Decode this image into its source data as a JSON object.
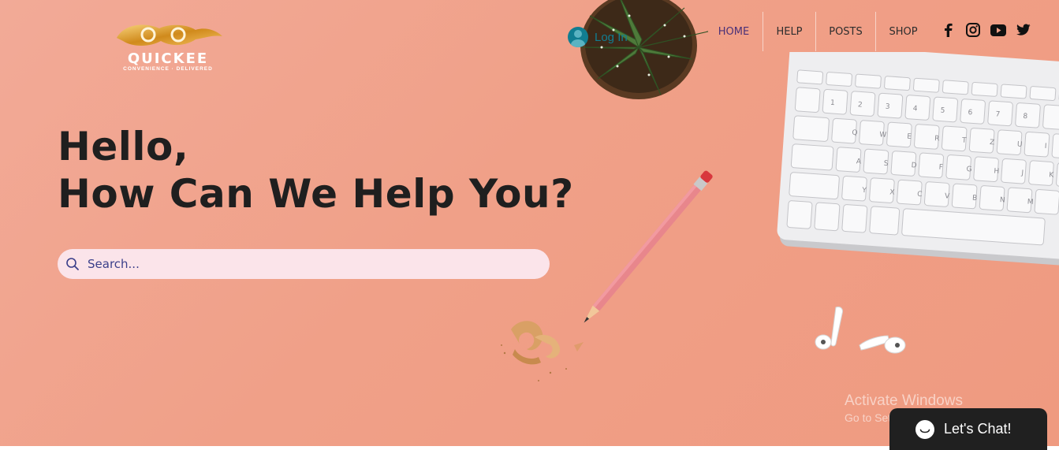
{
  "brand": {
    "name": "QUICKEE",
    "tagline": "CONVENIENCE · DELIVERED"
  },
  "header": {
    "login_label": "Log In",
    "nav": [
      {
        "label": "HOME",
        "active": true
      },
      {
        "label": "HELP",
        "active": false
      },
      {
        "label": "POSTS",
        "active": false
      },
      {
        "label": "SHOP",
        "active": false
      }
    ],
    "social": [
      "facebook-icon",
      "instagram-icon",
      "youtube-icon",
      "twitter-icon"
    ]
  },
  "hero": {
    "line1": "Hello,",
    "line2": "How Can We Help You?",
    "search": {
      "placeholder": "Search...",
      "value": ""
    }
  },
  "watermark": {
    "title": "Activate Windows",
    "subtitle": "Go to Settings to activate Windows."
  },
  "chat": {
    "label": "Let's Chat!"
  },
  "colors": {
    "hero_bg": "#f0a088",
    "accent": "#4a3178",
    "search_bg": "#fbe4ea",
    "chat_bg": "#202020",
    "login": "#117d91"
  }
}
